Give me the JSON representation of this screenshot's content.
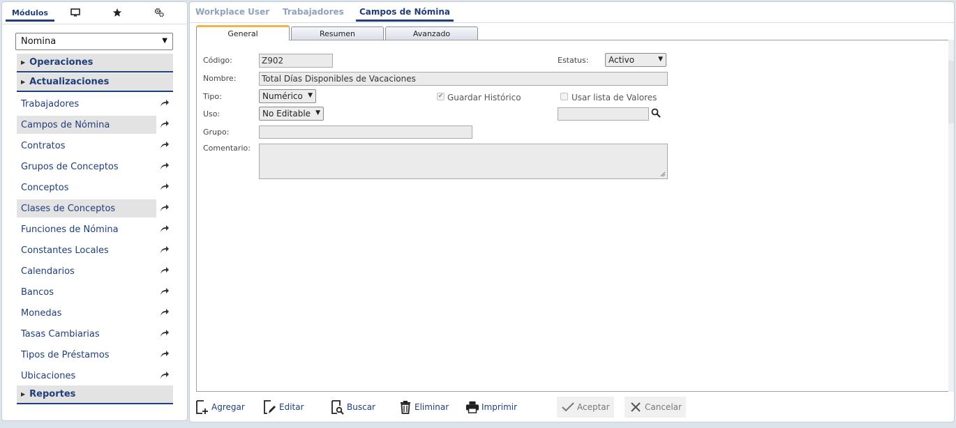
{
  "left_tabs": {
    "modulos_label": "Módulos"
  },
  "module_select": {
    "value": "Nomina"
  },
  "sections": {
    "operaciones": "Operaciones",
    "actualizaciones": "Actualizaciones",
    "reportes": "Reportes"
  },
  "nav_items": [
    "Trabajadores",
    "Campos de Nómina",
    "Contratos",
    "Grupos de Conceptos",
    "Conceptos",
    "Clases de Conceptos",
    "Funciones de Nómina",
    "Constantes Locales",
    "Calendarios",
    "Bancos",
    "Monedas",
    "Tasas Cambiarias",
    "Tipos de Préstamos",
    "Ubicaciones"
  ],
  "breadcrumbs": [
    "Workplace User",
    "Trabajadores",
    "Campos de Nómina"
  ],
  "form_tabs": [
    "General",
    "Resumen",
    "Avanzado"
  ],
  "form": {
    "codigo_label": "Código:",
    "codigo_value": "Z902",
    "estatus_label": "Estatus:",
    "estatus_value": "Activo",
    "nombre_label": "Nombre:",
    "nombre_value": "Total Días Disponibles de Vacaciones",
    "tipo_label": "Tipo:",
    "tipo_value": "Numérico",
    "guardar_historico_label": "Guardar Histórico",
    "usar_lista_label": "Usar lista de Valores",
    "uso_label": "Uso:",
    "uso_value": "No Editable",
    "grupo_label": "Grupo:",
    "comentario_label": "Comentario:"
  },
  "toolbar": {
    "agregar": "Agregar",
    "editar": "Editar",
    "buscar": "Buscar",
    "eliminar": "Eliminar",
    "imprimir": "Imprimir",
    "aceptar": "Aceptar",
    "cancelar": "Cancelar"
  },
  "colors": {
    "accent": "#1f3e7a",
    "tab_highlight": "#f0b544",
    "muted_link": "#8fa3bd"
  }
}
